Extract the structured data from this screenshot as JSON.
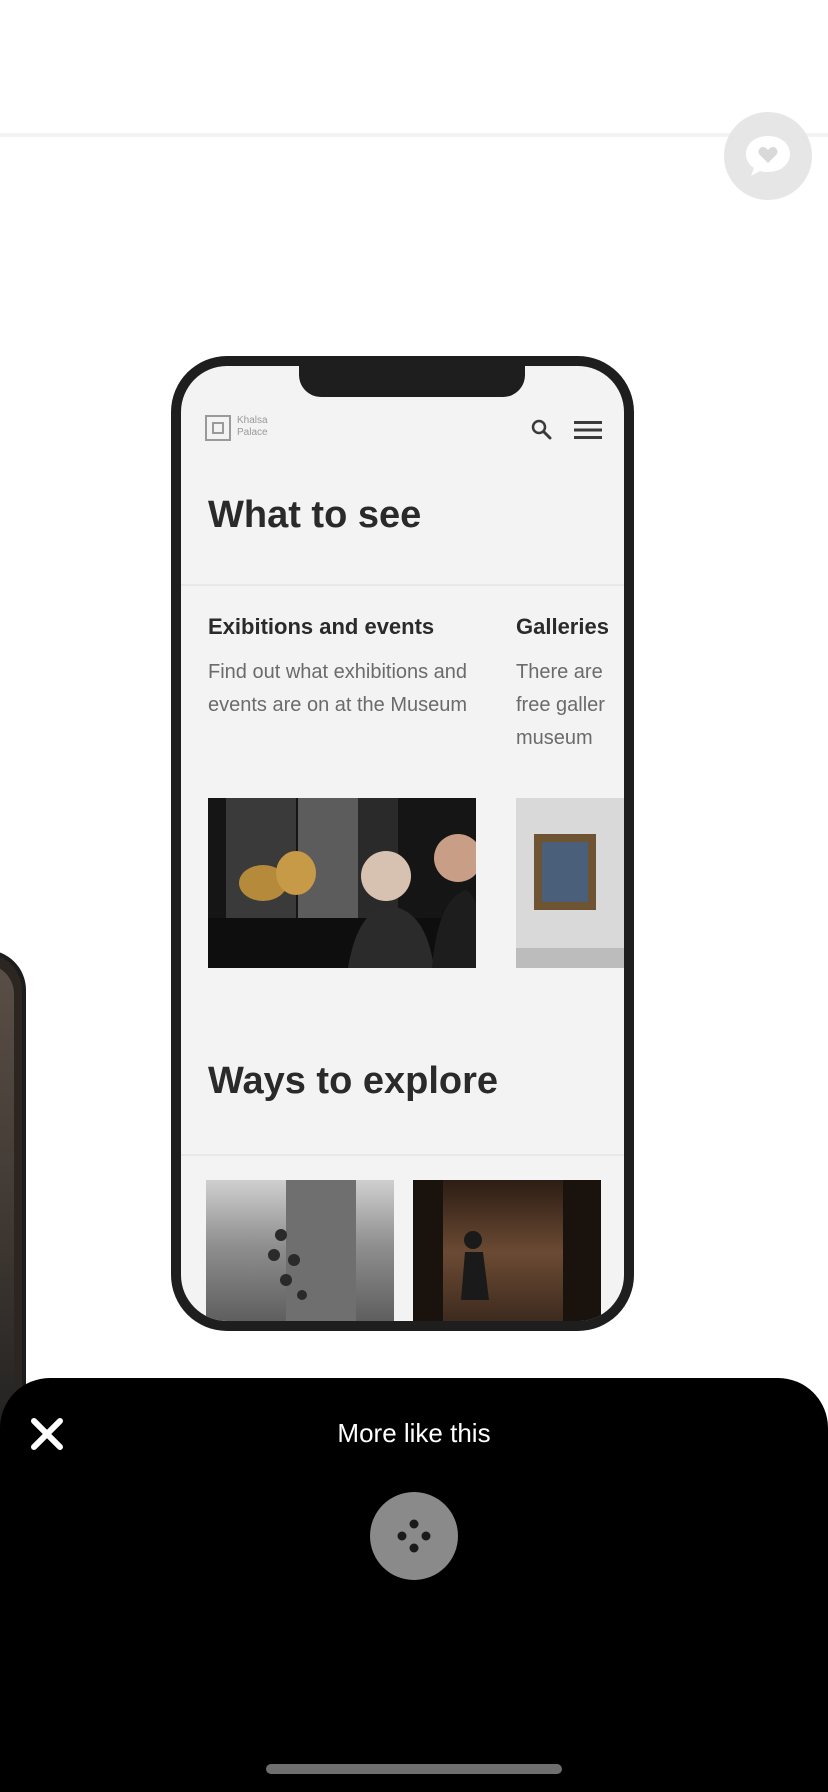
{
  "colors": {
    "background": "#ffffff",
    "sheet": "#000000",
    "sheet_text": "#ffffff",
    "icon_gray": "#8a8a8a"
  },
  "chat_button": {
    "icon": "heart-chat-icon"
  },
  "phone_mockup": {
    "logo_text": "Khalsa\nPalace",
    "search_icon": "search-icon",
    "menu_icon": "hamburger-menu-icon",
    "heading": "What to see",
    "cards": [
      {
        "title": "Exibitions and events",
        "description": "Find out what exhibitions and events are on at the Museum"
      },
      {
        "title": "Galleries",
        "description": "There are\nfree galler\nmuseum"
      }
    ],
    "explore_heading": "Ways to explore"
  },
  "sheet": {
    "close_icon": "close-icon",
    "title": "More like this",
    "more_icon": "more-dots-icon"
  }
}
